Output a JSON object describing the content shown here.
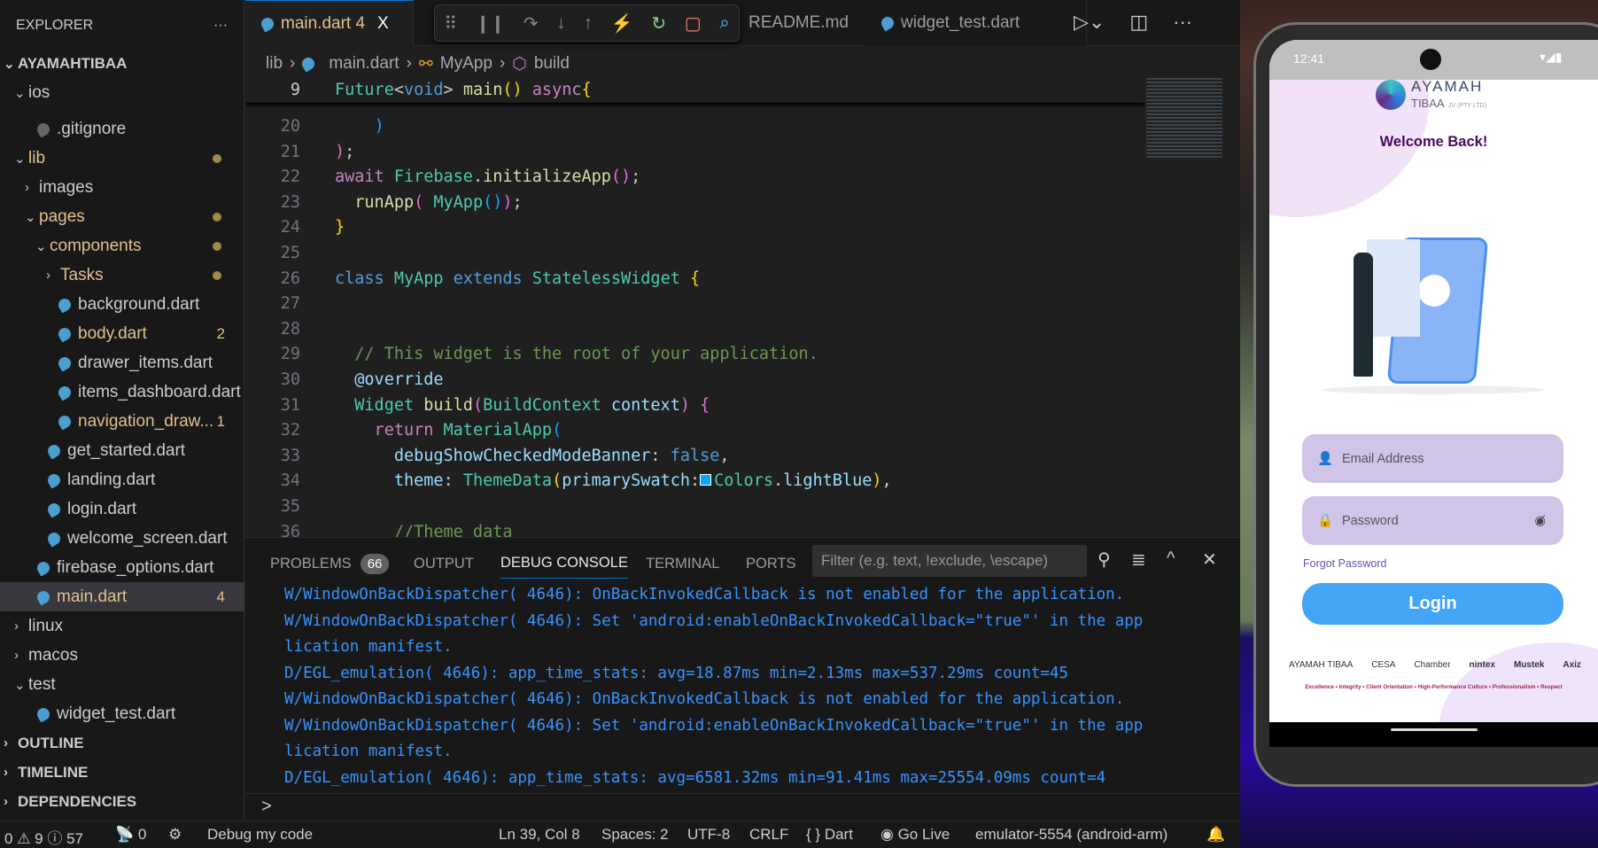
{
  "explorer": {
    "title": "EXPLORER",
    "more": "···",
    "items": [
      {
        "label": "AYAMAHTIBAA",
        "indent": 0,
        "chev": "v",
        "type": "root"
      },
      {
        "label": "ios",
        "indent": 1,
        "chev": "v"
      },
      {
        "label": ".gitignore",
        "indent": 2,
        "icon": "git"
      },
      {
        "label": "lib",
        "indent": 1,
        "chev": "v",
        "mod": true,
        "dot": true
      },
      {
        "label": "images",
        "indent": 2,
        "chev": ">"
      },
      {
        "label": "pages",
        "indent": 2,
        "chev": "v",
        "mod": true,
        "dot": true
      },
      {
        "label": "components",
        "indent": 3,
        "chev": "v",
        "mod": true,
        "dot": true
      },
      {
        "label": "Tasks",
        "indent": 4,
        "chev": ">",
        "mod": true,
        "dot": true
      },
      {
        "label": "background.dart",
        "indent": 4,
        "icon": "dart"
      },
      {
        "label": "body.dart",
        "indent": 4,
        "icon": "dart",
        "mod": true,
        "badge": "2"
      },
      {
        "label": "drawer_items.dart",
        "indent": 4,
        "icon": "dart"
      },
      {
        "label": "items_dashboard.dart",
        "indent": 4,
        "icon": "dart"
      },
      {
        "label": "navigation_draw...",
        "indent": 4,
        "icon": "dart",
        "mod": true,
        "badge": "1"
      },
      {
        "label": "get_started.dart",
        "indent": 3,
        "icon": "dart"
      },
      {
        "label": "landing.dart",
        "indent": 3,
        "icon": "dart"
      },
      {
        "label": "login.dart",
        "indent": 3,
        "icon": "dart"
      },
      {
        "label": "welcome_screen.dart",
        "indent": 3,
        "icon": "dart"
      },
      {
        "label": "firebase_options.dart",
        "indent": 2,
        "icon": "dart"
      },
      {
        "label": "main.dart",
        "indent": 2,
        "icon": "dart",
        "mod": true,
        "badge": "4",
        "selected": true
      },
      {
        "label": "linux",
        "indent": 1,
        "chev": ">"
      },
      {
        "label": "macos",
        "indent": 1,
        "chev": ">"
      },
      {
        "label": "test",
        "indent": 1,
        "chev": "v"
      },
      {
        "label": "widget_test.dart",
        "indent": 2,
        "icon": "dart"
      },
      {
        "label": "OUTLINE",
        "indent": 0,
        "chev": ">",
        "type": "root"
      },
      {
        "label": "TIMELINE",
        "indent": 0,
        "chev": ">",
        "type": "root"
      },
      {
        "label": "DEPENDENCIES",
        "indent": 0,
        "chev": ">",
        "type": "root"
      }
    ]
  },
  "tabs": [
    {
      "label": "main.dart 4",
      "active": true,
      "close": "X"
    },
    {
      "label": "README.md"
    },
    {
      "label": "widget_test.dart"
    }
  ],
  "breadcrumb": [
    "lib",
    "main.dart",
    "MyApp",
    "build"
  ],
  "sticky": {
    "num": "9",
    "tokens": [
      [
        "Future",
        "ty"
      ],
      [
        "<",
        "pl"
      ],
      [
        "void",
        "bl"
      ],
      [
        "> ",
        "pl"
      ],
      [
        "main",
        "fn"
      ],
      [
        "()",
        "br1"
      ],
      [
        " async",
        "kw"
      ],
      [
        "{",
        "br1"
      ]
    ]
  },
  "code": [
    {
      "num": "20",
      "tokens": [
        [
          "    ",
          "pl"
        ],
        [
          ")",
          "br3"
        ]
      ]
    },
    {
      "num": "21",
      "tokens": [
        [
          ")",
          "br2"
        ],
        [
          ";",
          "pl"
        ]
      ]
    },
    {
      "num": "22",
      "tokens": [
        [
          "await ",
          "kw"
        ],
        [
          "Firebase",
          "ty"
        ],
        [
          ".",
          "pl"
        ],
        [
          "initializeApp",
          "fn"
        ],
        [
          "()",
          "br2"
        ],
        [
          ";",
          "pl"
        ]
      ]
    },
    {
      "num": "23",
      "tokens": [
        [
          "  ",
          "pl"
        ],
        [
          "runApp",
          "fn"
        ],
        [
          "( ",
          "br2"
        ],
        [
          "MyApp",
          "ty"
        ],
        [
          "()",
          "br3"
        ],
        [
          ")",
          "br2"
        ],
        [
          ";",
          "pl"
        ]
      ]
    },
    {
      "num": "24",
      "tokens": [
        [
          "}",
          "br1"
        ]
      ]
    },
    {
      "num": "25",
      "tokens": []
    },
    {
      "num": "26",
      "tokens": [
        [
          "class ",
          "bl"
        ],
        [
          "MyApp",
          "ty"
        ],
        [
          " extends ",
          "bl"
        ],
        [
          "StatelessWidget",
          "ty"
        ],
        [
          " {",
          "br1"
        ]
      ]
    },
    {
      "num": "27",
      "tokens": []
    },
    {
      "num": "28",
      "tokens": []
    },
    {
      "num": "29",
      "tokens": [
        [
          "  // This widget is the root of your application.",
          "cm"
        ]
      ]
    },
    {
      "num": "30",
      "tokens": [
        [
          "  @override",
          "va"
        ]
      ]
    },
    {
      "num": "31",
      "tokens": [
        [
          "  ",
          "pl"
        ],
        [
          "Widget",
          "ty"
        ],
        [
          " build",
          "fn"
        ],
        [
          "(",
          "br2"
        ],
        [
          "BuildContext",
          "ty"
        ],
        [
          " context",
          "va"
        ],
        [
          ")",
          "br2"
        ],
        [
          " {",
          "br2"
        ]
      ]
    },
    {
      "num": "32",
      "tokens": [
        [
          "    return ",
          "kw"
        ],
        [
          "MaterialApp",
          "ty"
        ],
        [
          "(",
          "br3"
        ]
      ]
    },
    {
      "num": "33",
      "tokens": [
        [
          "      debugShowCheckedModeBanner",
          "va"
        ],
        [
          ": ",
          "pl"
        ],
        [
          "false",
          "bl"
        ],
        [
          ",",
          "pl"
        ]
      ]
    },
    {
      "num": "34",
      "tokens": [
        [
          "      theme",
          "va"
        ],
        [
          ": ",
          "pl"
        ],
        [
          "ThemeData",
          "ty"
        ],
        [
          "(",
          "br1"
        ],
        [
          "primarySwatch",
          "va"
        ],
        [
          ":",
          "pl"
        ],
        [
          "■",
          "swatch"
        ],
        [
          "Colors",
          "ty"
        ],
        [
          ".",
          "pl"
        ],
        [
          "lightBlue",
          "va"
        ],
        [
          ")",
          "br1"
        ],
        [
          ",",
          "pl"
        ]
      ]
    },
    {
      "num": "35",
      "tokens": []
    },
    {
      "num": "36",
      "tokens": [
        [
          "      //Theme data",
          "cm"
        ]
      ]
    }
  ],
  "panel": {
    "tabs": [
      "PROBLEMS",
      "OUTPUT",
      "DEBUG CONSOLE",
      "TERMINAL",
      "PORTS"
    ],
    "problems_count": "66",
    "filter_placeholder": "Filter (e.g. text, !exclude, \\escape)",
    "lines": [
      "W/WindowOnBackDispatcher( 4646): OnBackInvokedCallback is not enabled for the application.",
      "W/WindowOnBackDispatcher( 4646): Set 'android:enableOnBackInvokedCallback=\"true\"' in the app",
      "lication manifest.",
      "D/EGL_emulation( 4646): app_time_stats: avg=18.87ms min=2.13ms max=537.29ms count=45",
      "W/WindowOnBackDispatcher( 4646): OnBackInvokedCallback is not enabled for the application.",
      "W/WindowOnBackDispatcher( 4646): Set 'android:enableOnBackInvokedCallback=\"true\"' in the app",
      "lication manifest.",
      "D/EGL_emulation( 4646): app_time_stats: avg=6581.32ms min=91.41ms max=25554.09ms count=4"
    ],
    "prompt": ">"
  },
  "status": {
    "errors": "0",
    "warnings": "9",
    "info": "57",
    "ports": "0",
    "debug": "Debug my code",
    "position": "Ln 39, Col 8",
    "spaces": "Spaces: 2",
    "encoding": "UTF-8",
    "eol": "CRLF",
    "language": "Dart",
    "golive": "Go Live",
    "device": "emulator-5554 (android-arm)"
  },
  "phone": {
    "time": "12:41",
    "logo_line1": "AYAMAH",
    "logo_line2": "TIBAA",
    "logo_suffix": "JV (PTY LTD)",
    "welcome": "Welcome Back!",
    "email_placeholder": "Email Address",
    "password_placeholder": "Password",
    "forgot": "Forgot Password",
    "login": "Login",
    "partners": [
      "AYAMAH TIBAA",
      "CESA",
      "Chamber",
      "nintex",
      "Mustek",
      "Axiz"
    ],
    "tagline": "Excellence • Integrity • Client Orientation • High-Performance Culture • Professionalism • Respect",
    "colors": {
      "welcome": "#4a0a5e",
      "field": "#d1c4e9",
      "login": "#42a5f5",
      "forgot": "#6a4fb3"
    }
  }
}
